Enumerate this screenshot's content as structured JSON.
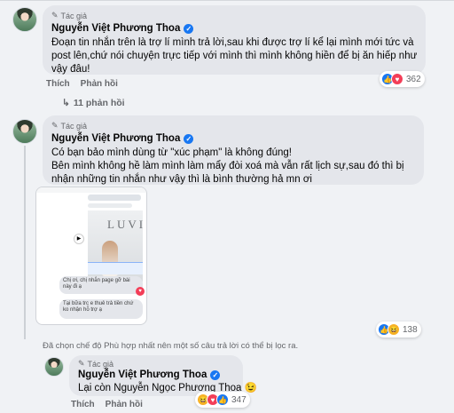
{
  "comments": [
    {
      "author_tag": "Tác giả",
      "name": "Nguyễn Việt Phương Thoa",
      "text": "Đoạn tin nhắn trên là trợ lí mình trả lời,sau khi được trợ lí kể lại mình mới tức và post lên,chứ nói chuyện trực tiếp với mình thì mình không hiền để bị ăn hiếp như vậy đâu!",
      "like_label": "Thích",
      "reply_label": "Phản hồi",
      "reaction_count": "362",
      "reactions": [
        "like",
        "love"
      ],
      "replies_label": "11 phản hồi"
    },
    {
      "author_tag": "Tác giả",
      "name": "Nguyễn Việt Phương Thoa",
      "text": "Có bạn bảo mình dùng từ \"xúc phạm\" là không đúng!\nBên mình không hề làm mình làm mẩy đòi xoá mà vẫn rất lịch sự,sau đó thì bị nhận những tin nhắn như vậy thì là bình thường hả mn ơi",
      "reaction_count": "138",
      "reactions": [
        "like",
        "haha"
      ],
      "screenshot": {
        "chat_line_1": "Chị ơi, chị nhắn page gỡ bài này đi ạ",
        "chat_line_2": "Tại bữa trc e thuê trả tiền chứ ko nhận hỗ trợ ạ",
        "brand_text": "LUVI"
      }
    },
    {
      "author_tag": "Tác giả",
      "name": "Nguyễn Việt Phương Thoa",
      "text": "Lại còn Nguyễn Ngọc Phương Thoa 😉",
      "like_label": "Thích",
      "reply_label": "Phản hồi",
      "reaction_count": "347",
      "reactions": [
        "haha",
        "love",
        "like"
      ]
    }
  ],
  "filter_note": "Đã chọn chế độ Phù hợp nhất nên một số câu trả lời có thể bị lọc ra.",
  "icons": {
    "verified": "verified-badge-icon",
    "pen": "pen-icon",
    "reply_arrow": "reply-arrow-icon"
  },
  "colors": {
    "bubble": "#e4e6eb",
    "like": "#1877f2",
    "love": "#f33e58",
    "haha": "#f7b125"
  }
}
